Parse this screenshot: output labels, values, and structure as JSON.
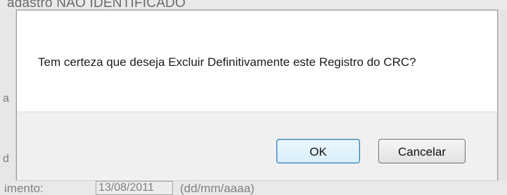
{
  "background": {
    "top_text": "adastro NAO IDENTIFICADO",
    "left_chars": [
      "a",
      "d"
    ],
    "date_label": "imento:",
    "date_value": "13/08/2011",
    "date_hint": "(dd/mm/aaaa)"
  },
  "dialog": {
    "message": "Tem certeza que deseja Excluir Definitivamente este Registro do CRC?",
    "ok_label": "OK",
    "cancel_label": "Cancelar"
  }
}
